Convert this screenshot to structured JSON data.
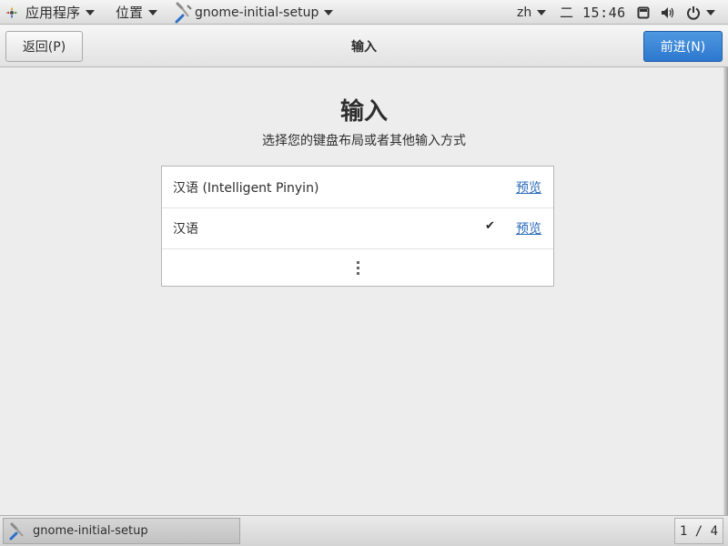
{
  "top_panel": {
    "apps_menu_label": "应用程序",
    "places_menu_label": "位置",
    "app_menu_label": "gnome-initial-setup",
    "language": "zh",
    "clock": "二 15:46",
    "icons": [
      "apps-logo-icon",
      "tool-icon",
      "window-icon",
      "volume-icon",
      "power-icon"
    ]
  },
  "header_bar": {
    "back_label": "返回(P)",
    "title": "输入",
    "next_label": "前进(N)"
  },
  "main": {
    "title": "输入",
    "subtitle": "选择您的键盘布局或者其他输入方式",
    "input_sources": [
      {
        "label": "汉语 (Intelligent Pinyin)",
        "preview_label": "预览",
        "selected": false
      },
      {
        "label": "汉语",
        "preview_label": "预览",
        "selected": true
      }
    ],
    "more_icon": "more-vertical-icon"
  },
  "taskbar": {
    "window_label": "gnome-initial-setup",
    "workspace": "1 / 4"
  },
  "colors": {
    "accent": "#2d78cf",
    "link": "#2a6ab8",
    "background": "#ededed"
  }
}
